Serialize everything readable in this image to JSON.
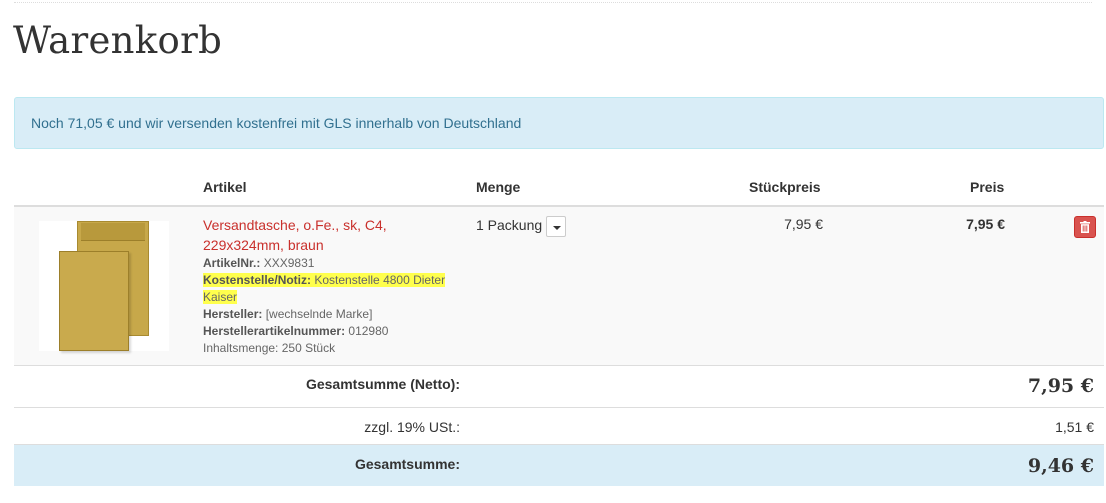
{
  "page": {
    "title": "Warenkorb"
  },
  "shipping_notice": "Noch 71,05 € und wir versenden kostenfrei mit GLS innerhalb von Deutschland",
  "table_headers": {
    "artikel": "Artikel",
    "menge": "Menge",
    "stueckpreis": "Stückpreis",
    "preis": "Preis"
  },
  "item": {
    "name": "Versandtasche, o.Fe., sk, C4, 229x324mm, braun",
    "artikelnr_label": "ArtikelNr.:",
    "artikelnr": "XXX9831",
    "kostenstelle_label": "Kostenstelle/Notiz:",
    "kostenstelle": "Kostenstelle 4800 Dieter Kaiser",
    "hersteller_label": "Hersteller:",
    "hersteller": "[wechselnde Marke]",
    "herstellerartikelnummer_label": "Herstellerartikelnummer:",
    "herstellerartikelnummer": "012980",
    "inhaltsmenge": "Inhaltsmenge: 250 Stück",
    "quantity": "1 Packung",
    "unit_price": "7,95 €",
    "price": "7,95 €",
    "image_icon": "envelope-image",
    "delete_icon": "trash-icon"
  },
  "totals": {
    "netto_label": "Gesamtsumme (Netto):",
    "netto_value": "7,95 €",
    "vat_label": "zzgl. 19% USt.:",
    "vat_value": "1,51 €",
    "total_label": "Gesamtsumme:",
    "total_value": "9,46 €"
  },
  "colors": {
    "info_bg": "#d9edf7",
    "info_text": "#31708f",
    "product_link": "#c9302c",
    "delete_button": "#d9534f",
    "highlight": "#ffff4d"
  }
}
